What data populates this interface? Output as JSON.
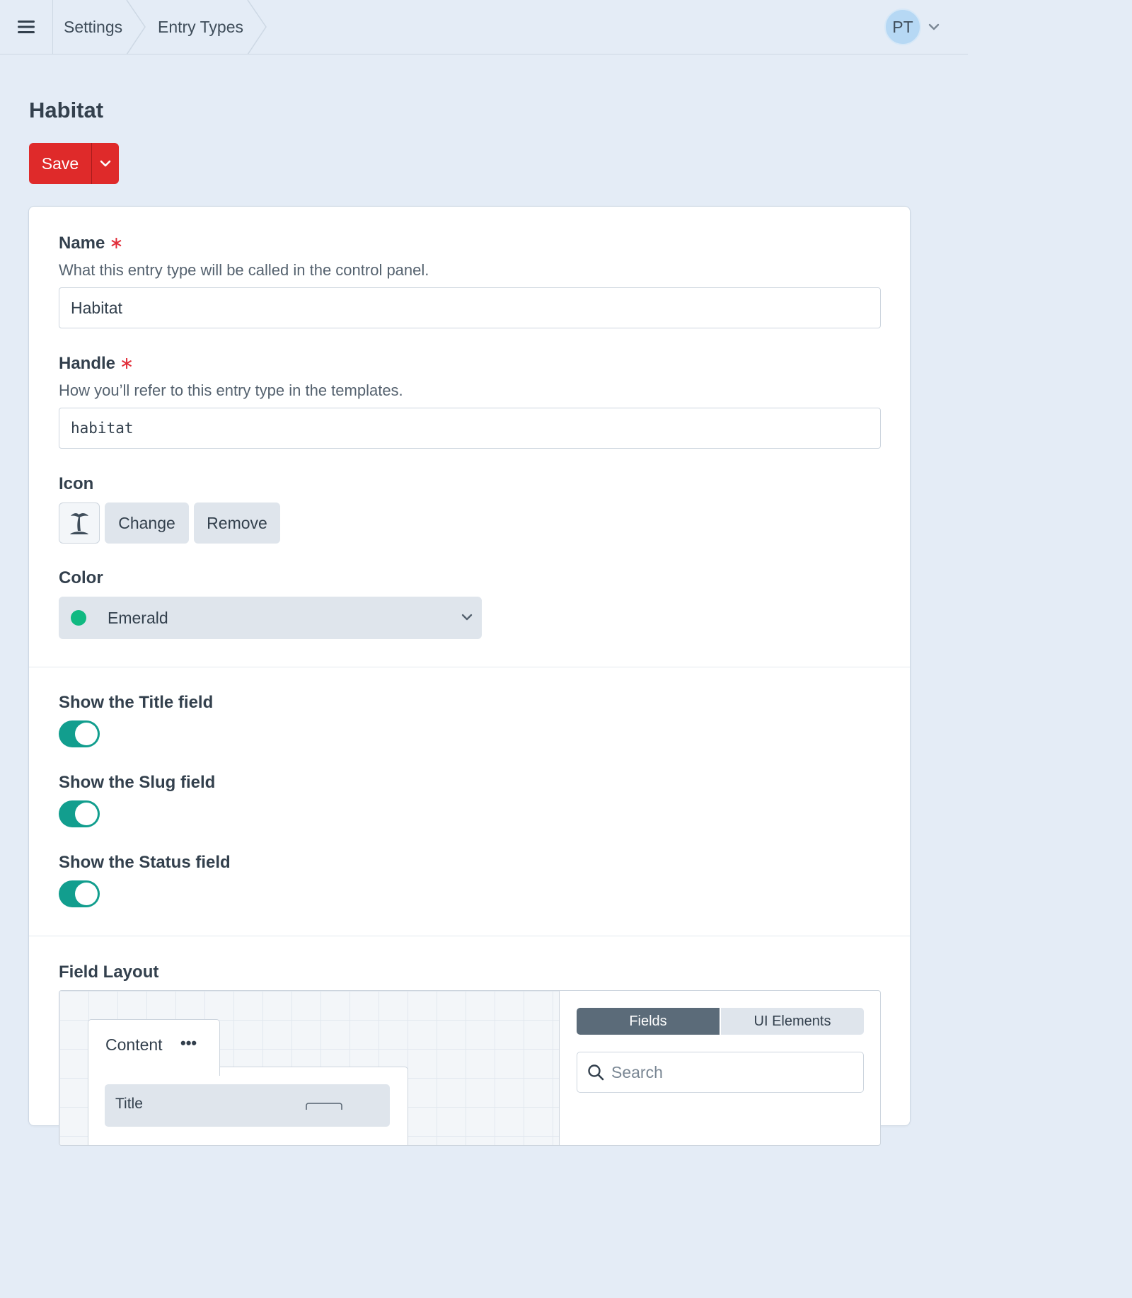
{
  "breadcrumb": {
    "items": [
      "Settings",
      "Entry Types"
    ]
  },
  "user": {
    "initials": "PT"
  },
  "page": {
    "title": "Habitat"
  },
  "toolbar": {
    "save_label": "Save"
  },
  "form": {
    "name": {
      "label": "Name",
      "required_mark": "∗",
      "instructions": "What this entry type will be called in the control panel.",
      "value": "Habitat"
    },
    "handle": {
      "label": "Handle",
      "required_mark": "∗",
      "instructions": "How you’ll refer to this entry type in the templates.",
      "value": "habitat"
    },
    "icon": {
      "label": "Icon",
      "icon_name": "palm-tree-island-icon",
      "change_label": "Change",
      "remove_label": "Remove"
    },
    "color": {
      "label": "Color",
      "value": "Emerald",
      "swatch": "#10b981"
    },
    "toggles": [
      {
        "label": "Show the Title field",
        "on": true
      },
      {
        "label": "Show the Slug field",
        "on": true
      },
      {
        "label": "Show the Status field",
        "on": true
      }
    ],
    "field_layout": {
      "label": "Field Layout",
      "tab_name": "Content",
      "tab_menu": "•••",
      "fields": [
        "Title"
      ],
      "library_tabs": [
        "Fields",
        "UI Elements"
      ],
      "search_placeholder": "Search"
    }
  },
  "colors": {
    "accent": "#df2a2a",
    "toggle_on": "#129e8e",
    "background": "#e4ecf6"
  }
}
